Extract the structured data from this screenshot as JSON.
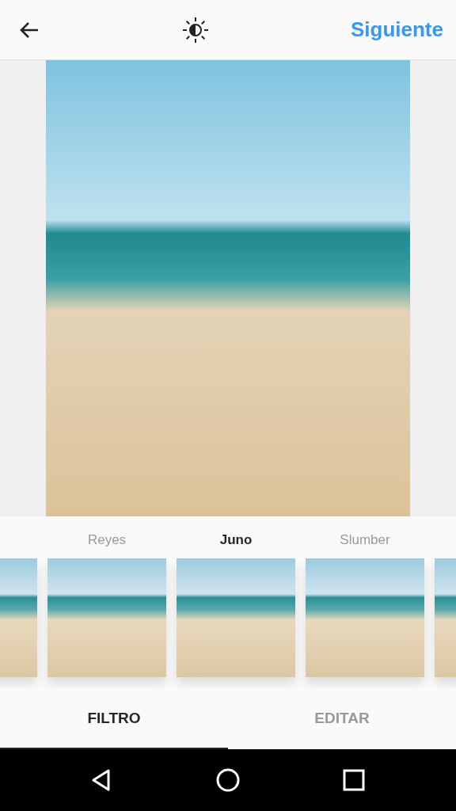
{
  "header": {
    "next_label": "Siguiente"
  },
  "filters": [
    {
      "name": "Reyes",
      "selected": false
    },
    {
      "name": "Juno",
      "selected": true
    },
    {
      "name": "Slumber",
      "selected": false
    }
  ],
  "tabs": [
    {
      "label": "FILTRO",
      "selected": true
    },
    {
      "label": "EDITAR",
      "selected": false
    }
  ]
}
